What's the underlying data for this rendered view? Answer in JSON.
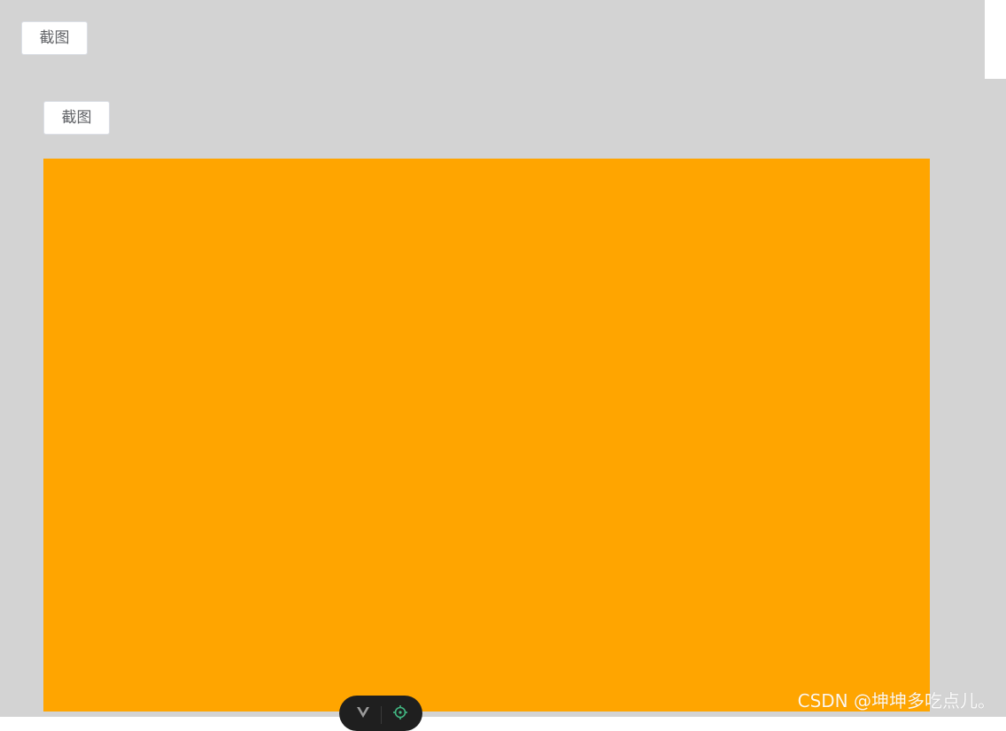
{
  "toolbar": {
    "screenshot_label_outer": "截图",
    "screenshot_label_inner": "截图"
  },
  "canvas": {
    "color": "#ffa500"
  },
  "colors": {
    "page_background": "#d3d3d3",
    "button_background": "#ffffff",
    "devtools_pill": "#1f1f1f",
    "target_icon": "#42b883"
  },
  "devtools": {
    "icons": [
      "vue-logo-icon",
      "target-icon"
    ]
  },
  "watermark": {
    "text": "CSDN @坤坤多吃点儿。"
  }
}
